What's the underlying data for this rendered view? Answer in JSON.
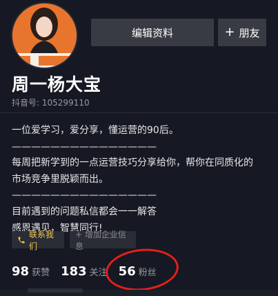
{
  "profile": {
    "name": "周一杨大宝",
    "douyin_id_label": "抖音号:",
    "douyin_id_value": "105299110",
    "bio_lines": [
      "一位爱学习，爱分享，懂运营的90后。",
      "———————————————",
      "每周把新学到的一点运营技巧分享给你，帮你在同质化的",
      "市场竞争里脱颖而出。",
      "———————————————",
      "目前遇到的问题私信都会一一解答",
      "感恩遇见，智慧同行!"
    ]
  },
  "buttons": {
    "edit_profile": "编辑资料",
    "add_friend": "朋友",
    "add_friend_icon": "+"
  },
  "tags": {
    "contact": "联系我们",
    "contact_icon": "phone-icon",
    "company": "+ 增加企业信息"
  },
  "stats": [
    {
      "value": "98",
      "label": "获赞"
    },
    {
      "value": "183",
      "label": "关注"
    },
    {
      "value": "56",
      "label": "粉丝"
    }
  ],
  "colors": {
    "background": "#161823",
    "button": "#393b44",
    "contact_accent": "#f7c948",
    "highlight_circle": "#e3211a",
    "avatar_bg": "#e8752e"
  }
}
